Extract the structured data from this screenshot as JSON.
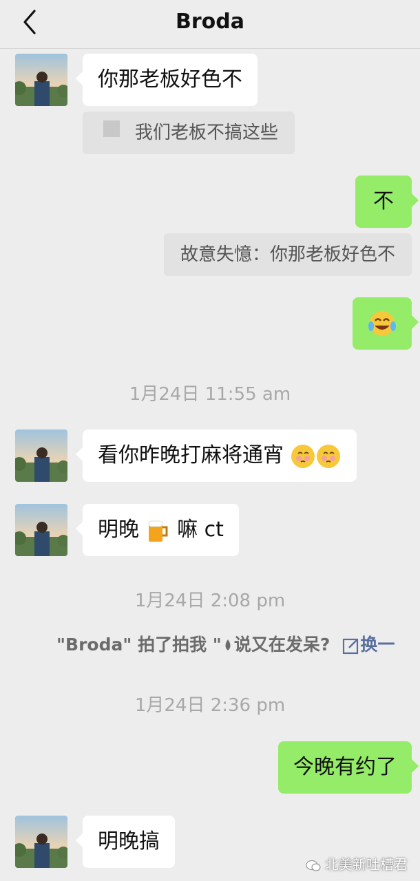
{
  "header": {
    "title": "Broda"
  },
  "messages": {
    "m1": "你那老板好色不",
    "q1": "我们老板不搞这些",
    "m2": "不",
    "q2": "故意失憶：你那老板好色不",
    "m4": "看你昨晚打麻将通宵",
    "m5a": "明晚",
    "m5b": "嘛 ct",
    "m6": "今晚有约了",
    "m7": "明晚搞"
  },
  "timestamps": {
    "t1": "1月24日 11:55 am",
    "t2": "1月24日 2:08 pm",
    "t3": "1月24日 2:36 pm"
  },
  "pat": {
    "text": "\"Broda\" 拍了拍我 \"",
    "rest": "说又在发呆?",
    "edit": "换一"
  },
  "watermark": "北美新吐槽君",
  "colors": {
    "background": "#ededed",
    "sent_bubble": "#95ec69",
    "received_bubble": "#ffffff",
    "quote_bg": "#e2e2e2"
  }
}
